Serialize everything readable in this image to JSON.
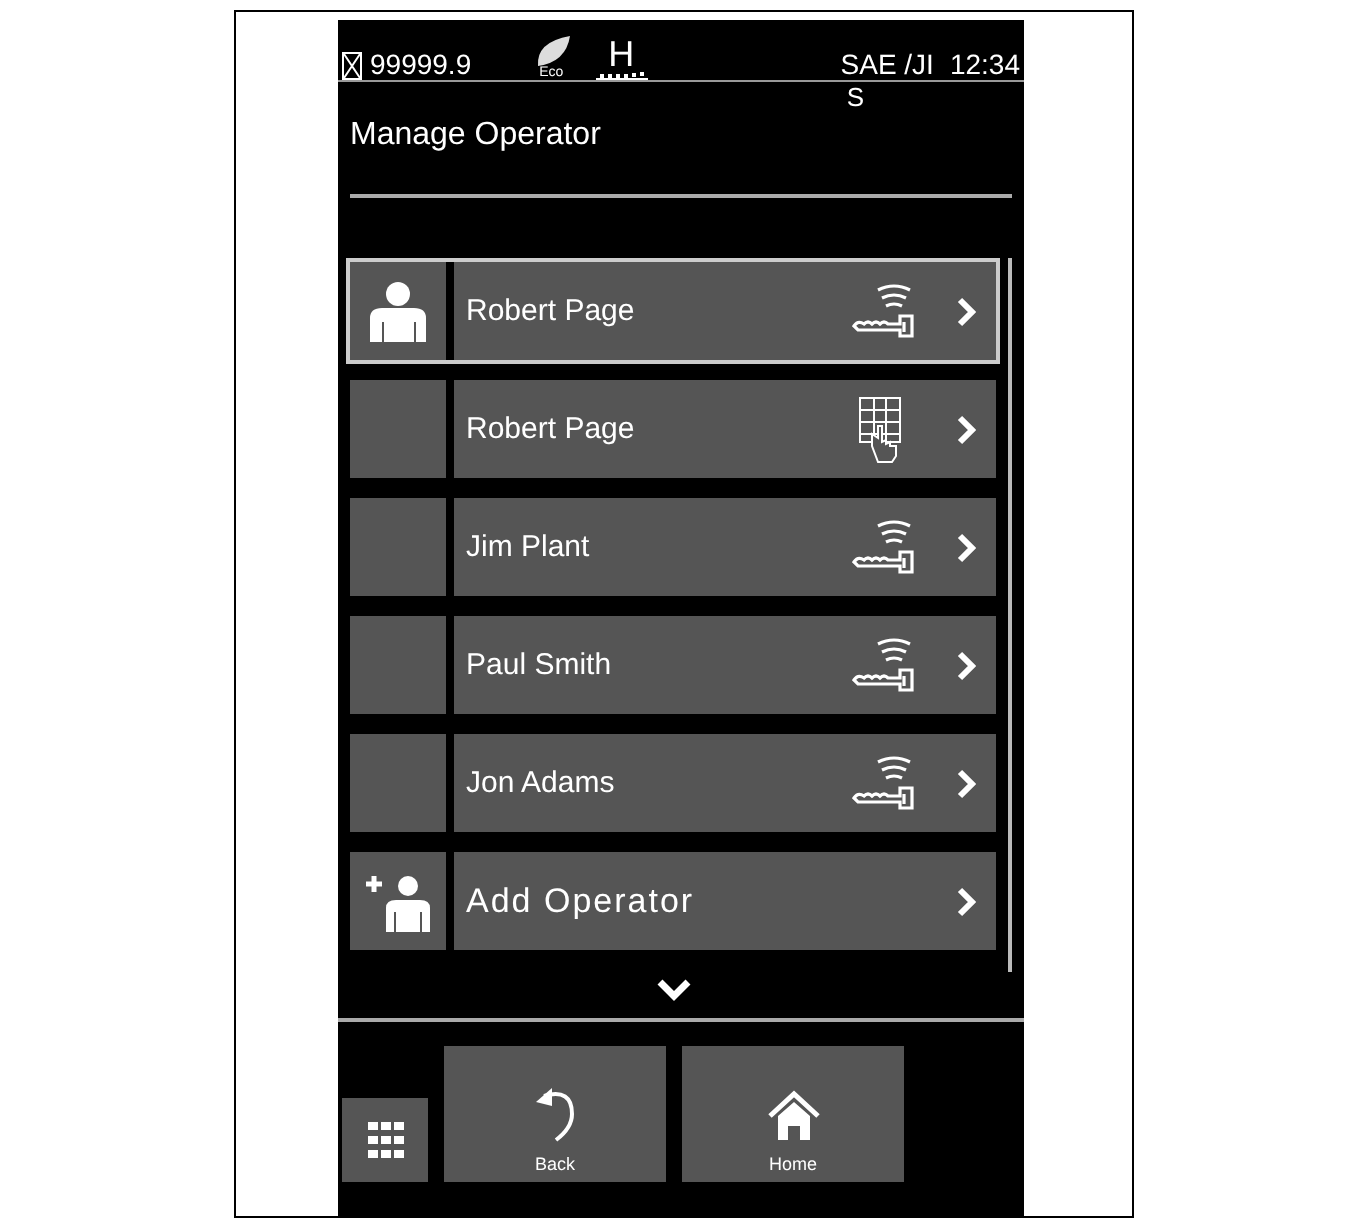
{
  "status_bar": {
    "hours": "99999.9",
    "eco_label": "Eco",
    "mode": "H",
    "units": "SAE /JI",
    "units_overflow": "S",
    "time": "12:34"
  },
  "title": "Manage Operator",
  "operators": [
    {
      "name": "Robert Page",
      "kind": "key",
      "selected": true
    },
    {
      "name": "Robert Page",
      "kind": "keypad",
      "selected": false
    },
    {
      "name": "Jim Plant",
      "kind": "key",
      "selected": false
    },
    {
      "name": "Paul Smith",
      "kind": "key",
      "selected": false
    },
    {
      "name": "Jon Adams",
      "kind": "key",
      "selected": false
    },
    {
      "name": "Add Operator",
      "kind": "add",
      "selected": false
    }
  ],
  "buttons": [
    {
      "label": "Back",
      "kind": "back"
    },
    {
      "label": "Home",
      "kind": "home"
    }
  ]
}
